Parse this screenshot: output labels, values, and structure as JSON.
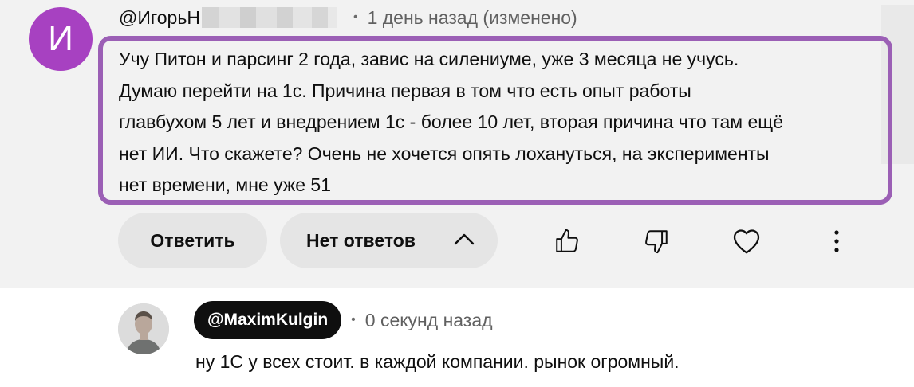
{
  "comment": {
    "avatar_letter": "И",
    "author": "@ИгорьН",
    "time": "1 день назад (изменено)",
    "text_lines": [
      "Учу Питон и парсинг 2 года, завис на силениуме, уже 3 месяца не учусь.",
      "Думаю перейти на 1с. Причина первая в том что есть опыт работы",
      "главбухом 5 лет и внедрением 1с - более 10 лет, вторая причина что там ещё",
      "нет ИИ. Что скажете? Очень не хочется опять лохануться, на эксперименты",
      "нет времени, мне уже 51"
    ],
    "reply_label": "Ответить",
    "replies_label": "Нет ответов",
    "highlight_color": "#9b5fb5",
    "avatar_color": "#a741c1"
  },
  "actions": {
    "like_icon": "thumbs-up-icon",
    "dislike_icon": "thumbs-down-icon",
    "heart_icon": "heart-icon",
    "more_icon": "more-vertical-icon"
  },
  "reply": {
    "author": "@MaximKulgin",
    "time": "0 секунд назад",
    "text": "ну 1С у всех стоит. в каждой компании. рынок огромный."
  }
}
